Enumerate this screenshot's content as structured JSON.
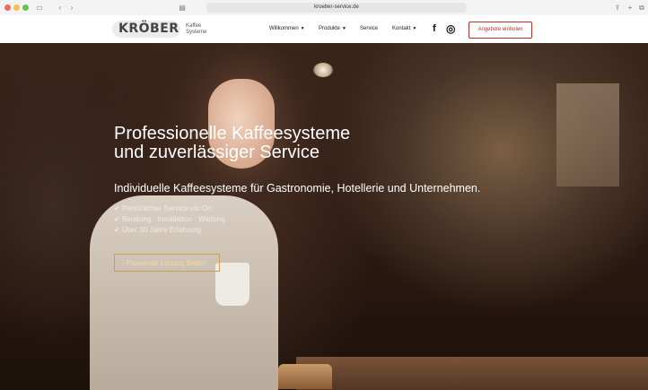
{
  "browser": {
    "url": "kroeber-service.de",
    "back_icon": "chevron-left-icon",
    "forward_icon": "chevron-right-icon"
  },
  "brand": {
    "logo_text": "KRÖBER",
    "tagline_line1": "Kaffee",
    "tagline_line2": "Systeme",
    "accent": "#b8332b"
  },
  "nav": {
    "items": [
      {
        "label": "Willkommen",
        "dropdown": true
      },
      {
        "label": "Produkte",
        "dropdown": true
      },
      {
        "label": "Service",
        "dropdown": false
      },
      {
        "label": "Kontakt",
        "dropdown": true
      }
    ],
    "facebook_icon": "f",
    "instagram_icon": "◎",
    "cta_label": "Angebote einholen"
  },
  "hero": {
    "headline_line1": "Professionelle Kaffeesysteme",
    "headline_line2": "und zuverlässiger Service",
    "subheadline": "Individuelle Kaffeesysteme für Gastronomie, Hotellerie und Unternehmen.",
    "bullets": [
      "✔ Persönlicher Service vor Ort",
      "✔ Beratung · Installation · Wartung",
      "✔ Über 30 Jahre Erfahrung"
    ],
    "button_label": "› Passende Lösung finden",
    "button_color": "#c8a05a"
  }
}
